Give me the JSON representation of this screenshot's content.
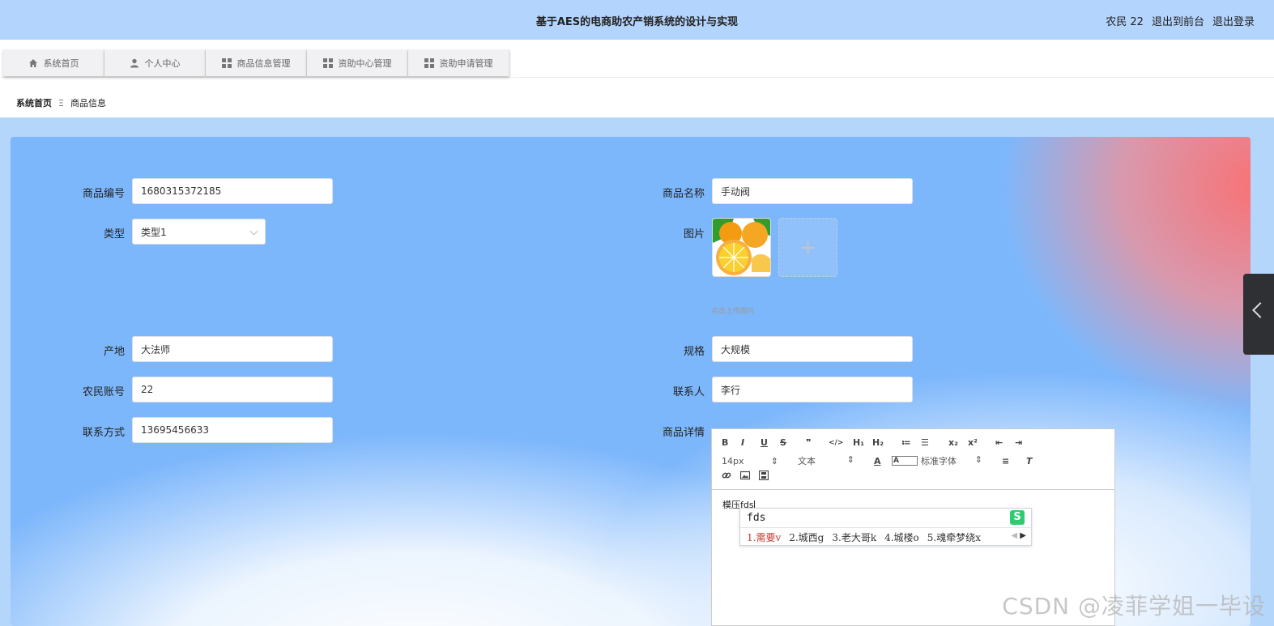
{
  "header": {
    "title": "基于AES的电商助农产销系统的设计与实现",
    "user_label": "农民 22",
    "front_link": "退出到前台",
    "logout_link": "退出登录"
  },
  "nav": {
    "tabs": [
      {
        "label": "系统首页",
        "icon": "home-icon"
      },
      {
        "label": "个人中心",
        "icon": "user-icon"
      },
      {
        "label": "商品信息管理",
        "icon": "grid-icon"
      },
      {
        "label": "资助中心管理",
        "icon": "grid-icon"
      },
      {
        "label": "资助申请管理",
        "icon": "grid-icon"
      }
    ]
  },
  "breadcrumb": {
    "home": "系统首页",
    "separator": "Ξ",
    "current": "商品信息"
  },
  "form": {
    "product_no": {
      "label": "商品编号",
      "value": "1680315372185"
    },
    "product_name": {
      "label": "商品名称",
      "value": "手动阀"
    },
    "type": {
      "label": "类型",
      "value": "类型1"
    },
    "image": {
      "label": "图片",
      "hint": "点击上传图片",
      "add_symbol": "+"
    },
    "origin": {
      "label": "产地",
      "value": "大法师"
    },
    "spec": {
      "label": "规格",
      "value": "大规模"
    },
    "farmer_account": {
      "label": "农民账号",
      "value": "22"
    },
    "contact_person": {
      "label": "联系人",
      "value": "李行"
    },
    "contact_phone": {
      "label": "联系方式",
      "value": "13695456633"
    },
    "detail": {
      "label": "商品详情",
      "content": "模压fds"
    }
  },
  "editor": {
    "font_size": "14px",
    "text_style": "文本",
    "font_family": "标准字体",
    "buttons_row1": [
      "B",
      "I",
      "U",
      "S",
      "❞",
      "</>",
      "H₁",
      "H₂",
      "≔",
      "☰",
      "x₂",
      "x²",
      "⇤",
      "⇥"
    ],
    "buttons_row3": [
      "link-icon",
      "image-icon",
      "video-icon"
    ]
  },
  "ime": {
    "composition": "fds",
    "candidates": [
      "1.需要v",
      "2.城西g",
      "3.老大哥k",
      "4.城楼o",
      "5.魂牵梦绕x"
    ],
    "logo": "S"
  },
  "watermark": "CSDN @凌菲学姐一毕设",
  "colors": {
    "header_bg": "#b3d4fc",
    "panel_bg": "#7db7fb",
    "accent_red": "#ff6e6e"
  }
}
